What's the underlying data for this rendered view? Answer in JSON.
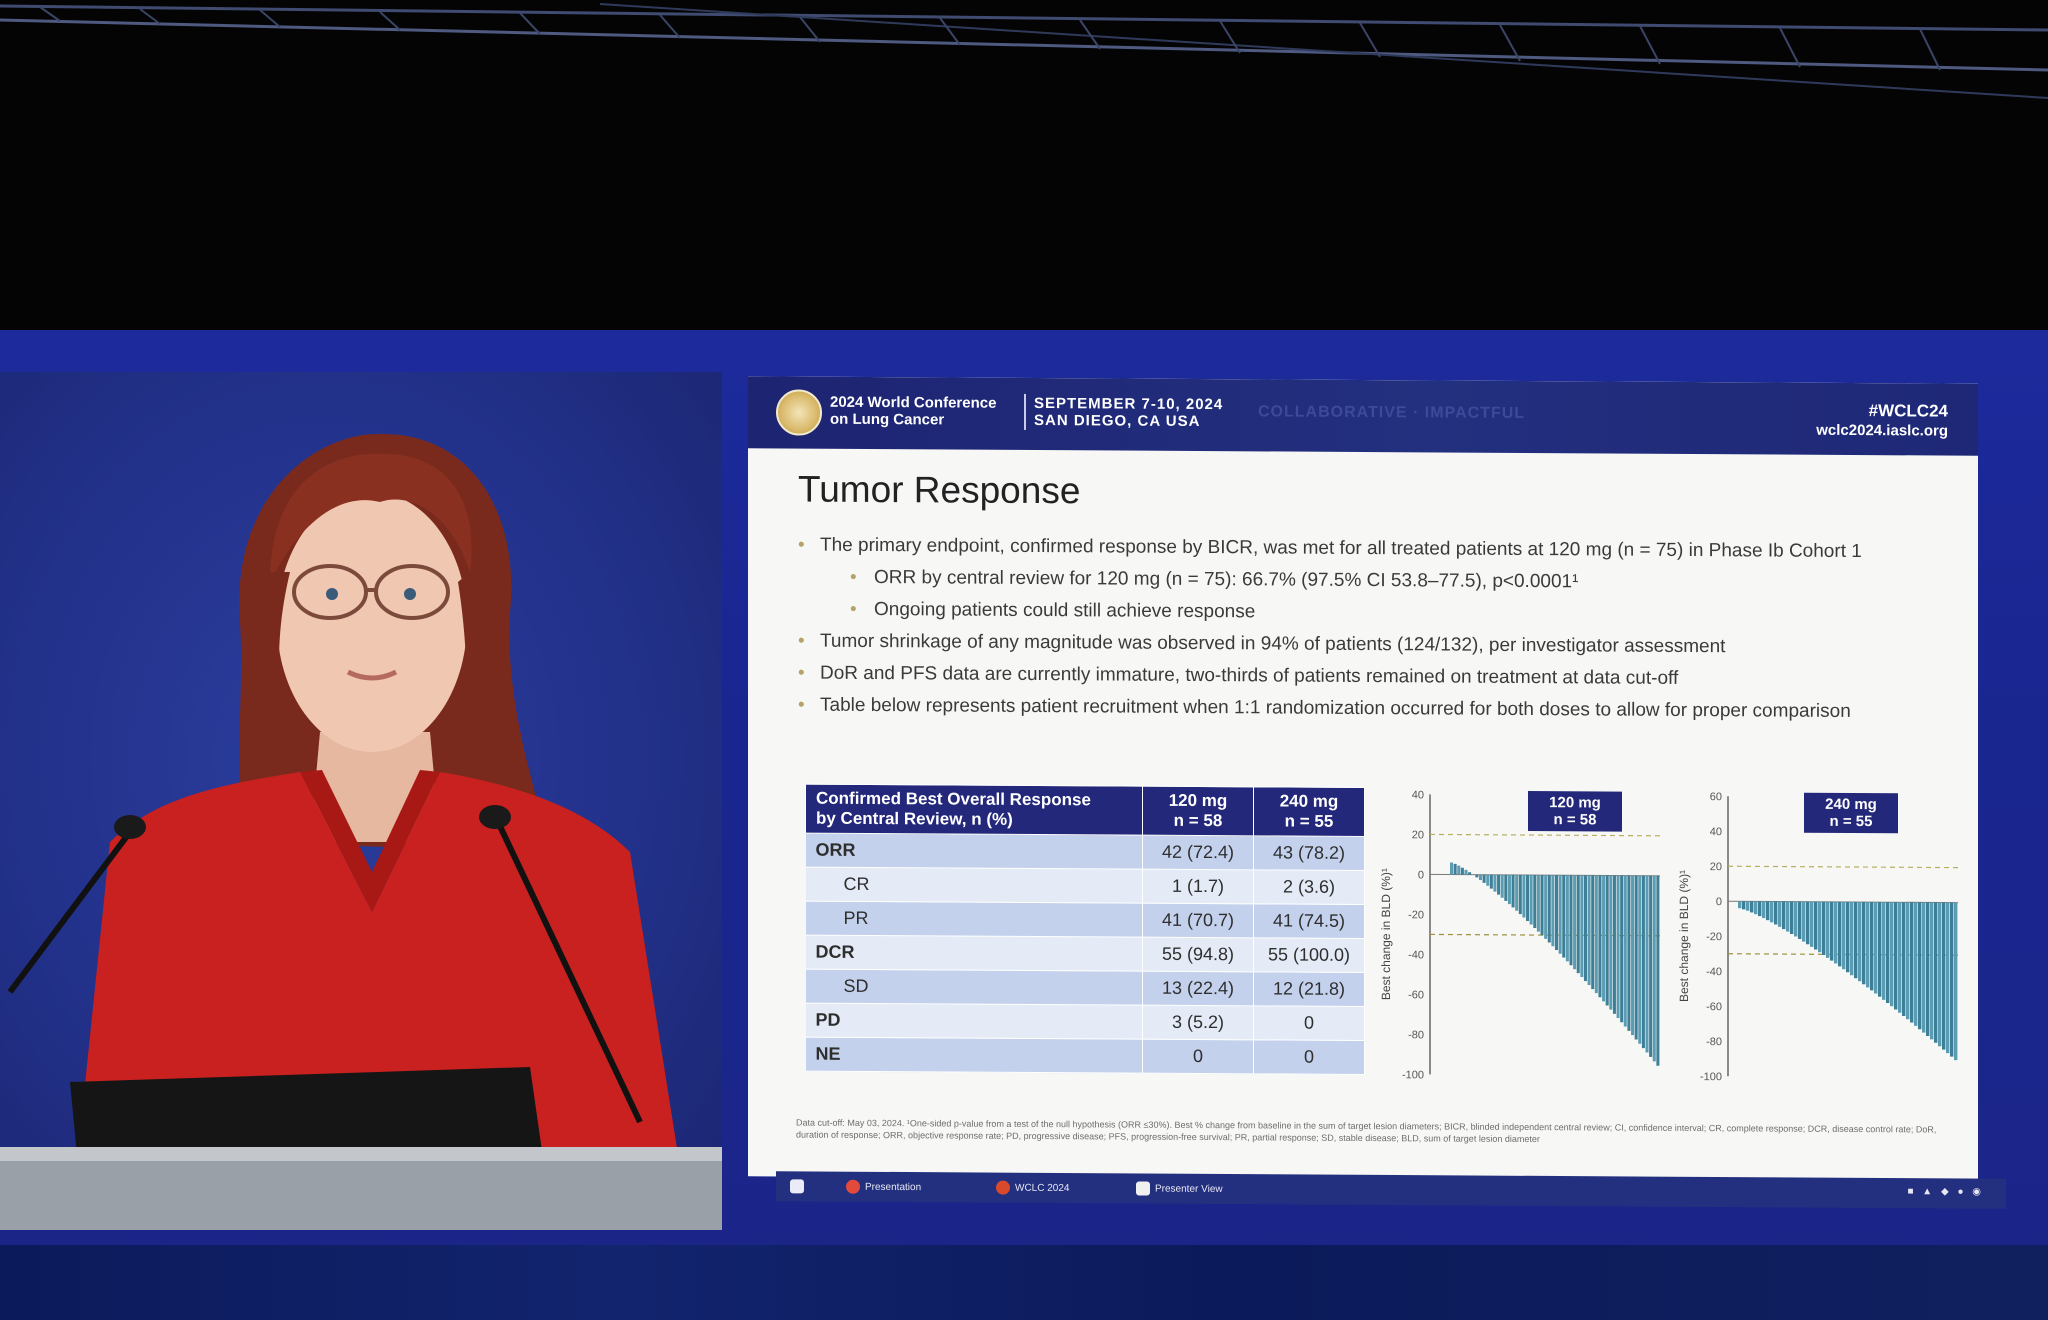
{
  "header": {
    "conference_name_line1": "2024 World Conference",
    "conference_name_line2": "on Lung Cancer",
    "dates": "SEPTEMBER 7-10, 2024",
    "location": "SAN DIEGO, CA USA",
    "tagline_words": "COLLABORATIVE  ·  IMPACTFUL",
    "hashtag": "#WCLC24",
    "website": "wclc2024.iaslc.org"
  },
  "slide": {
    "title": "Tumor Response",
    "bullets": [
      {
        "level": 1,
        "text": "The primary endpoint, confirmed response by BICR, was met for all treated patients at 120 mg (n = 75) in Phase Ib Cohort 1"
      },
      {
        "level": 2,
        "text": "ORR by central review for 120 mg (n = 75): 66.7% (97.5% CI 53.8–77.5), p<0.0001¹"
      },
      {
        "level": 2,
        "text": "Ongoing patients could still achieve response"
      },
      {
        "level": 1,
        "text": "Tumor shrinkage of any magnitude was observed in 94% of patients (124/132), per investigator assessment"
      },
      {
        "level": 1,
        "text": "DoR and PFS data are currently immature, two-thirds of patients remained on treatment at data cut-off"
      },
      {
        "level": 1,
        "text": "Table below represents patient recruitment when 1:1 randomization occurred for both doses to allow for proper comparison"
      }
    ],
    "table": {
      "header": {
        "col1_line1": "Confirmed Best Overall Response",
        "col1_line2": "by Central Review, n (%)",
        "col2_line1": "120 mg",
        "col2_line2": "n = 58",
        "col3_line1": "240 mg",
        "col3_line2": "n = 55"
      },
      "rows": [
        {
          "label": "ORR",
          "v120": "42 (72.4)",
          "v240": "43 (78.2)"
        },
        {
          "label": "CR",
          "v120": "1 (1.7)",
          "v240": "2 (3.6)"
        },
        {
          "label": "PR",
          "v120": "41 (70.7)",
          "v240": "41 (74.5)"
        },
        {
          "label": "DCR",
          "v120": "55 (94.8)",
          "v240": "55 (100.0)"
        },
        {
          "label": "SD",
          "v120": "13 (22.4)",
          "v240": "12 (21.8)"
        },
        {
          "label": "PD",
          "v120": "3 (5.2)",
          "v240": "0"
        },
        {
          "label": "NE",
          "v120": "0",
          "v240": "0"
        }
      ]
    },
    "waterfall_left": {
      "badge_line1": "120 mg",
      "badge_line2": "n = 58",
      "ylabel": "Best change in BLD (%)¹",
      "yticks": [
        "40",
        "20",
        "0",
        "-20",
        "-40",
        "-60",
        "-80",
        "-100"
      ]
    },
    "waterfall_right": {
      "badge_line1": "240 mg",
      "badge_line2": "n = 55",
      "ylabel": "Best change in BLD (%)¹",
      "yticks": [
        "60",
        "40",
        "20",
        "0",
        "-20",
        "-40",
        "-60",
        "-80",
        "-100"
      ]
    },
    "footnote": "Data cut-off: May 03, 2024. ¹One-sided p-value from a test of the null hypothesis (ORR ≤30%). Best % change from baseline in the sum of target lesion diameters; BICR, blinded independent central review; CI, confidence interval; CR, complete response; DCR, disease control rate; DoR, duration of response; ORR, objective response rate; PD, progressive disease; PFS, progression-free survival; PR, partial response; SD, stable disease; BLD, sum of target lesion diameter"
  },
  "taskbar": {
    "items": [
      "Presentation",
      "WCLC 2024",
      "Presenter View"
    ]
  },
  "colors": {
    "screen_blue": "#1c2a9c",
    "header_navy": "#1d2472",
    "table_header": "#23287a",
    "speaker_dress": "#c8211f",
    "waterfall_bar": "#4b8fa6"
  }
}
